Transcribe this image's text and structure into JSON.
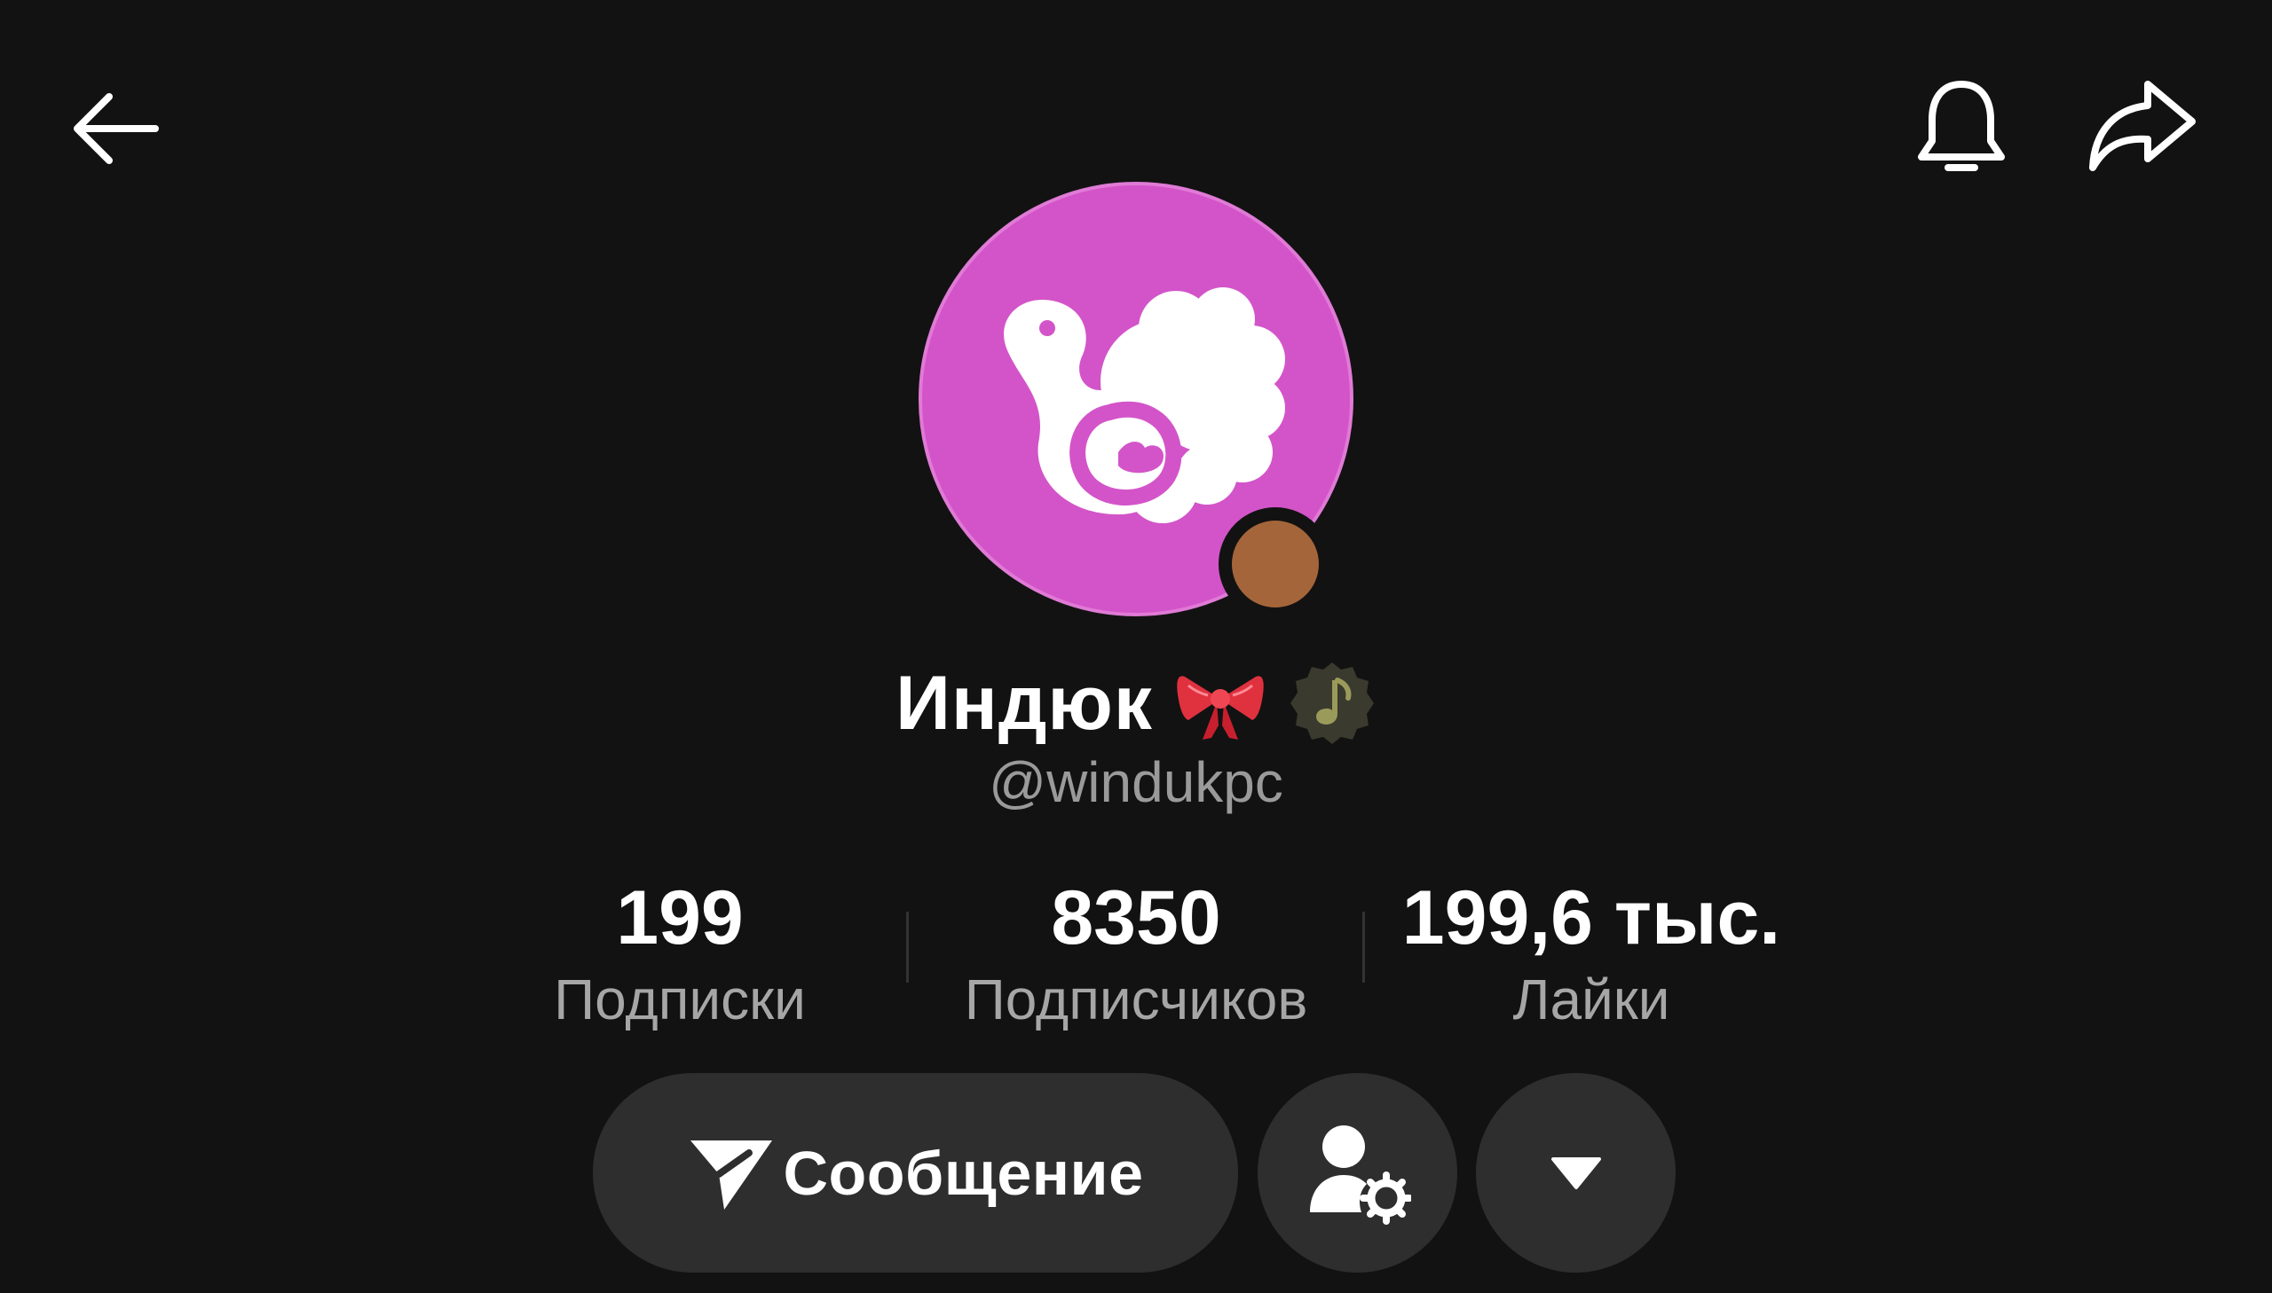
{
  "header": {
    "back_icon": "arrow-left-icon",
    "notifications_icon": "bell-icon",
    "share_icon": "share-arrow-icon"
  },
  "profile": {
    "avatar_color": "#d354c8",
    "avatar_icon": "turkey-logo-icon",
    "live_indicator_color": "#a5653a",
    "display_name": "Индюк",
    "name_emoji": "🎀",
    "badge_icon": "music-note-badge-icon",
    "handle": "@windukpc"
  },
  "stats": [
    {
      "value": "199",
      "label": "Подписки"
    },
    {
      "value": "8350",
      "label": "Подписчиков"
    },
    {
      "value": "199,6 тыс.",
      "label": "Лайки"
    }
  ],
  "actions": {
    "message_label": "Сообщение",
    "message_icon": "paper-plane-icon",
    "friends_icon": "user-settings-icon",
    "more_icon": "dropdown-triangle-icon"
  }
}
